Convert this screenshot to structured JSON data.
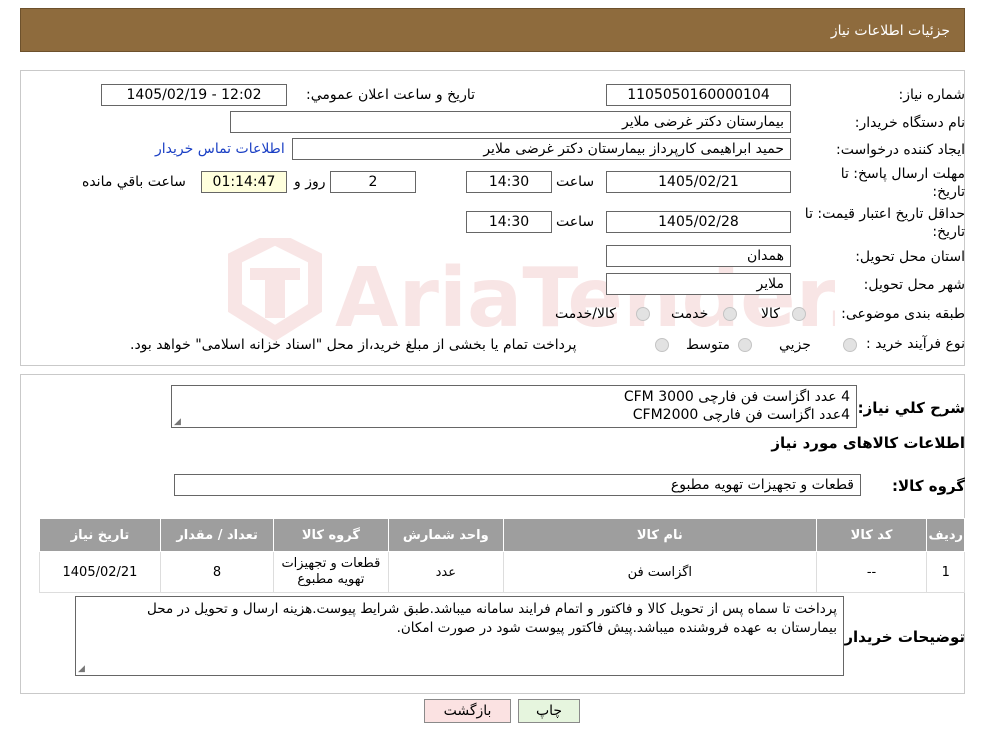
{
  "header": {
    "title": "جزئیات اطلاعات نیاز"
  },
  "need": {
    "number_label": "شماره نیاز:",
    "number": "1105050160000104",
    "announce_label": "تاريخ و ساعت اعلان عمومي:",
    "announce": "1405/02/19 - 12:02",
    "buyer_label": "نام دستگاه خریدار:",
    "buyer": "بیمارستان دکتر غرضی ملایر",
    "creator_label": "ایجاد کننده درخواست:",
    "creator": "حمید ابراهیمی کارپرداز بیمارستان دکتر غرضی ملایر",
    "contact_link": "اطلاعات تماس خریدار",
    "deadline_label_1": "مهلت ارسال پاسخ: تا",
    "deadline_label_2": "تاریخ:",
    "deadline_date": "1405/02/21",
    "time_label": "ساعت",
    "deadline_time": "14:30",
    "days": "2",
    "days_label": "روز و",
    "remaining": "01:14:47",
    "remaining_label": "ساعت باقي مانده",
    "validity_label_1": "حداقل تاریخ اعتبار قیمت: تا",
    "validity_label_2": "تاریخ:",
    "validity_date": "1405/02/28",
    "validity_time": "14:30",
    "province_label": "استان محل تحویل:",
    "province": "همدان",
    "city_label": "شهر محل تحویل:",
    "city": "ملایر",
    "category_label": "طبقه بندی موضوعی:",
    "category_options": [
      "کالا",
      "خدمت",
      "کالا/خدمت"
    ],
    "process_label": "نوع فرآیند خرید :",
    "process_options": [
      "جزیي",
      "متوسط"
    ],
    "process_note": "پرداخت تمام یا بخشی از مبلغ خرید،از محل \"اسناد خزانه اسلامی\" خواهد بود."
  },
  "description": {
    "label": "شرح كلي نياز:",
    "line1": "4 عدد اگزاست فن فارچی 3000 CFM",
    "line2": "4عدد اگزاست فن فارچی CFM2000"
  },
  "goods": {
    "section_title": "اطلاعات کالاهای مورد نیاز",
    "group_label": "گروه کالا:",
    "group": "قطعات و تجهیزات تهویه مطبوع",
    "columns": [
      "ردیف",
      "کد کالا",
      "نام کالا",
      "واحد شمارش",
      "گروه کالا",
      "تعداد / مقدار",
      "تاریخ نیاز"
    ],
    "rows": [
      {
        "row": "1",
        "code": "--",
        "name": "اگزاست فن",
        "unit": "عدد",
        "group_line1": "قطعات و تجهیزات",
        "group_line2": "تهویه مطبوع",
        "qty": "8",
        "date": "1405/02/21"
      }
    ]
  },
  "notes": {
    "label": "توضیحات خریدار:",
    "line1": "پرداخت تا سماه پس از تحویل کالا و فاکتور و اتمام فرایند سامانه میباشد.طبق شرایط پیوست.هزینه ارسال و تحویل در محل",
    "line2": "بیمارستان به عهده فروشنده میباشد.پیش فاکتور پیوست شود در صورت امکان."
  },
  "buttons": {
    "print": "چاپ",
    "back": "بازگشت"
  },
  "watermark": "AriaTender.neT",
  "colors": {
    "header": "#8e6b3d",
    "table_header": "#9e9e9e",
    "remaining_bg": "#ffffdd",
    "back_button": "#fbe2e2",
    "print_button": "#e6f5de"
  }
}
